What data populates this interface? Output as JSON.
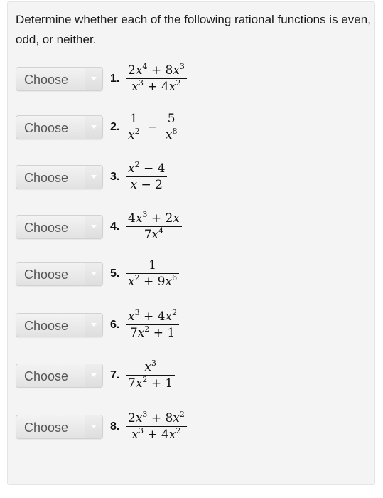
{
  "prompt": "Determine whether each of the following rational functions is even, odd, or neither.",
  "select_placeholder": "Choose",
  "questions": [
    {
      "number": "1.",
      "numerator": "2x^4 + 8x^3",
      "denominator": "x^3 + 4x^2"
    },
    {
      "number": "2.",
      "expression": "1/x^2 − 5/x^8"
    },
    {
      "number": "3.",
      "numerator": "x^2 − 4",
      "denominator": "x − 2"
    },
    {
      "number": "4.",
      "numerator": "4x^3 + 2x",
      "denominator": "7x^4"
    },
    {
      "number": "5.",
      "numerator": "1",
      "denominator": "x^2 + 9x^6"
    },
    {
      "number": "6.",
      "numerator": "x^3 + 4x^2",
      "denominator": "7x^2 + 1"
    },
    {
      "number": "7.",
      "numerator": "x^3",
      "denominator": "7x^2 + 1"
    },
    {
      "number": "8.",
      "numerator": "2x^3 + 8x^2",
      "denominator": "x^3 + 4x^2"
    }
  ]
}
